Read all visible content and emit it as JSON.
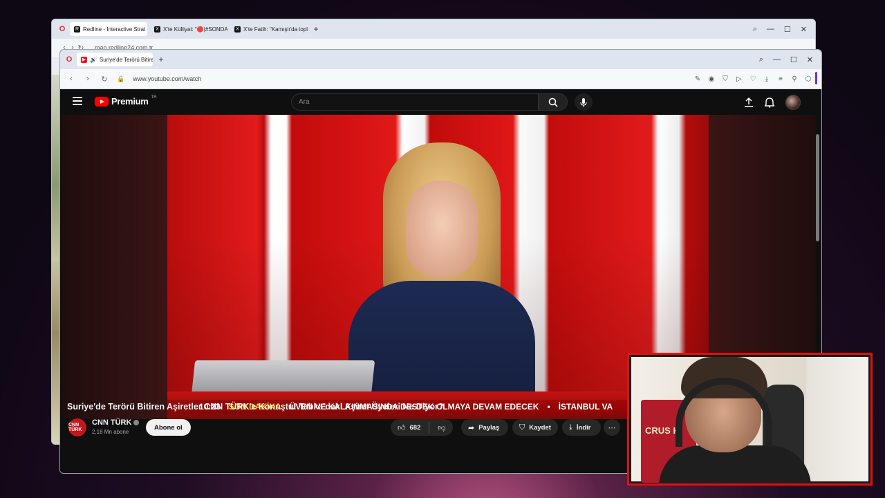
{
  "back_window": {
    "tabs": [
      {
        "label": "Redline - Interactive Strat",
        "favicon": "R"
      },
      {
        "label": "X'te Külliyat: \"🔴|#SONDA",
        "favicon": "X"
      },
      {
        "label": "X'te Fatih: \"Kamışlı'da topl",
        "favicon": "X"
      }
    ],
    "url": "map.redline24.com.tr"
  },
  "front_window": {
    "tab": {
      "label": "Suriye'de Terörü Bitire"
    },
    "url": "www.youtube.com/watch"
  },
  "youtube": {
    "brand": "Premium",
    "country": "TR",
    "search_placeholder": "Ara",
    "video": {
      "ticker_time": "10:23",
      "ticker_tag": "SON DAKİKA",
      "ticker_text": "ÜVEN VE KALKINMASINDA DESTEK OLMAYA DEVAM EDECEK",
      "ticker_sep": "•",
      "ticker_text2": "İSTANBUL VA"
    },
    "title": "Suriye'de Terörü Bitiren Aşiretler CNN TÜRK'e Konuştu! Tabka'daki Aşiret Üyeleri Ne Diyor?",
    "channel": {
      "logo_text": "CNN TÜRK",
      "name": "CNN TÜRK",
      "subscribers": "2,18 Mn abone",
      "subscribe_label": "Abone ol"
    },
    "actions": {
      "likes": "682",
      "share": "Paylaş",
      "save": "Kaydet",
      "download": "İndir"
    }
  },
  "webcam": {
    "banner_text": "CRUS KI"
  },
  "colors": {
    "yt_red": "#ff0000",
    "studio_red": "#e21b1b",
    "ticker_yellow": "#ffd400",
    "cam_border": "#e01010",
    "opera_red": "#e3262c"
  }
}
